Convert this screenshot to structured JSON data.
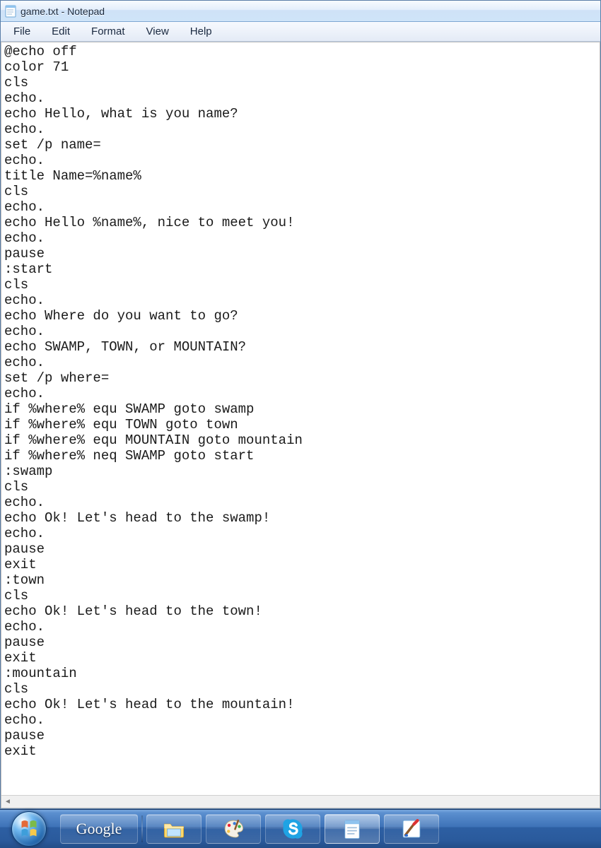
{
  "window": {
    "title": "game.txt - Notepad"
  },
  "menu": {
    "items": [
      "File",
      "Edit",
      "Format",
      "View",
      "Help"
    ]
  },
  "editor": {
    "content": "@echo off\ncolor 71\ncls\necho.\necho Hello, what is you name?\necho.\nset /p name=\necho.\ntitle Name=%name%\ncls\necho.\necho Hello %name%, nice to meet you!\necho.\npause\n:start\ncls\necho.\necho Where do you want to go?\necho.\necho SWAMP, TOWN, or MOUNTAIN?\necho.\nset /p where=\necho.\nif %where% equ SWAMP goto swamp\nif %where% equ TOWN goto town\nif %where% equ MOUNTAIN goto mountain\nif %where% neq SWAMP goto start\n:swamp\ncls\necho.\necho Ok! Let's head to the swamp!\necho.\npause\nexit\n:town\ncls\necho Ok! Let's head to the town!\necho.\npause\nexit\n:mountain\ncls\necho Ok! Let's head to the mountain!\necho.\npause\nexit"
  },
  "taskbar": {
    "google_label": "Google",
    "items": [
      "start",
      "google",
      "file-explorer",
      "paint",
      "skype",
      "notepad",
      "mspaint"
    ]
  }
}
